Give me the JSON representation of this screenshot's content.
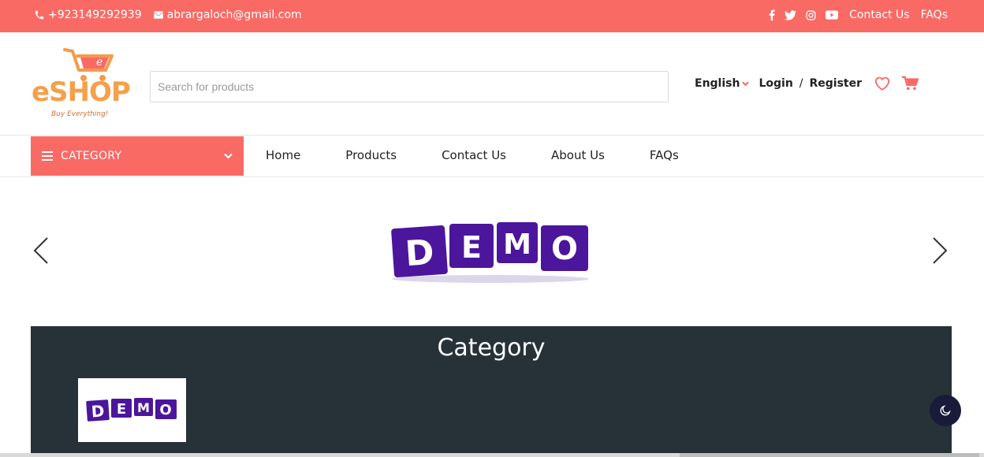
{
  "topbar": {
    "phone": "+923149292939",
    "email": "abrargaloch@gmail.com",
    "social_icons": [
      "facebook-icon",
      "twitter-icon",
      "instagram-icon",
      "youtube-icon"
    ],
    "contact_label": "Contact Us",
    "faqs_label": "FAQs"
  },
  "header": {
    "logo": {
      "brand": "eSHOP",
      "tagline": "Buy Everything!"
    },
    "search_placeholder": "Search for products",
    "language": "English",
    "login": "Login",
    "separator": "/",
    "register": "Register"
  },
  "nav": {
    "category_label": "CATEGORY",
    "links": [
      "Home",
      "Products",
      "Contact Us",
      "About Us",
      "FAQs"
    ]
  },
  "slider": {
    "banner_letters": [
      "D",
      "E",
      "M",
      "O"
    ]
  },
  "category_section": {
    "title": "Category",
    "cards": [
      {
        "image_letters": [
          "D",
          "E",
          "M",
          "O"
        ]
      }
    ]
  },
  "colors": {
    "accent": "#f96a65",
    "dark_section": "#263238",
    "demo_block": "#4b169c"
  }
}
